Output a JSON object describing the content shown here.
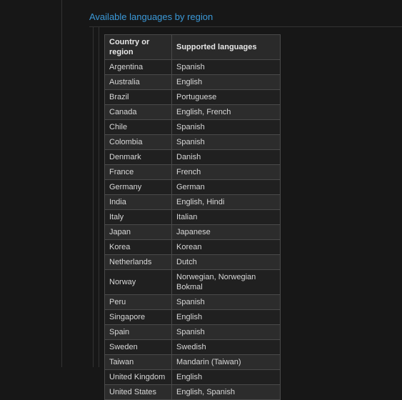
{
  "heading": "Available languages by region",
  "table": {
    "headers": {
      "country": "Country or region",
      "languages": "Supported languages"
    },
    "rows": [
      {
        "country": "Argentina",
        "languages": "Spanish"
      },
      {
        "country": "Australia",
        "languages": "English"
      },
      {
        "country": "Brazil",
        "languages": "Portuguese"
      },
      {
        "country": "Canada",
        "languages": "English, French"
      },
      {
        "country": "Chile",
        "languages": "Spanish"
      },
      {
        "country": "Colombia",
        "languages": "Spanish"
      },
      {
        "country": "Denmark",
        "languages": "Danish"
      },
      {
        "country": "France",
        "languages": "French"
      },
      {
        "country": "Germany",
        "languages": "German"
      },
      {
        "country": "India",
        "languages": "English, Hindi"
      },
      {
        "country": "Italy",
        "languages": "Italian"
      },
      {
        "country": "Japan",
        "languages": "Japanese"
      },
      {
        "country": "Korea",
        "languages": "Korean"
      },
      {
        "country": "Netherlands",
        "languages": "Dutch"
      },
      {
        "country": "Norway",
        "languages": "Norwegian, Norwegian Bokmal"
      },
      {
        "country": "Peru",
        "languages": "Spanish"
      },
      {
        "country": "Singapore",
        "languages": "English"
      },
      {
        "country": "Spain",
        "languages": "Spanish"
      },
      {
        "country": "Sweden",
        "languages": "Swedish"
      },
      {
        "country": "Taiwan",
        "languages": "Mandarin (Taiwan)"
      },
      {
        "country": "United Kingdom",
        "languages": "English"
      },
      {
        "country": "United States",
        "languages": "English, Spanish"
      }
    ]
  }
}
